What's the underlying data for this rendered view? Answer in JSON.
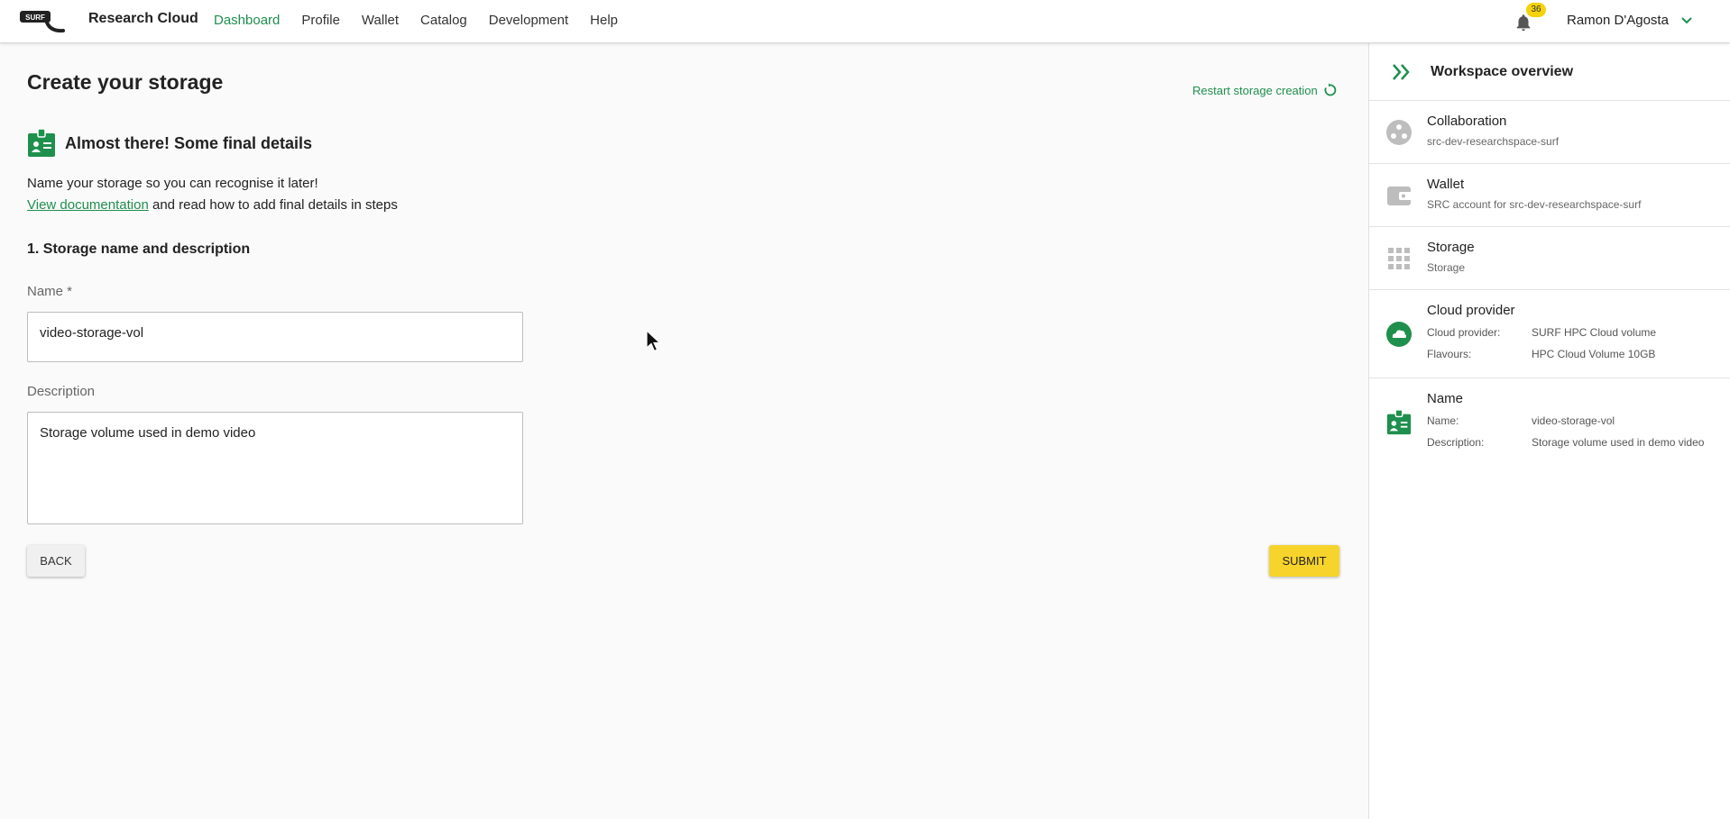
{
  "nav": {
    "brand": "Research Cloud",
    "logo_text": "SURF",
    "items": [
      "Dashboard",
      "Profile",
      "Wallet",
      "Catalog",
      "Development",
      "Help"
    ],
    "notifications": "36",
    "user": "Ramon D'Agosta"
  },
  "main": {
    "title": "Create your storage",
    "restart": "Restart storage creation",
    "step_title": "Almost there! Some final details",
    "intro_line1": "Name your storage so you can recognise it later!",
    "doc_link": "View documentation",
    "intro_line2": " and read how to add final details in steps",
    "section": "1. Storage name and description",
    "name_label": "Name *",
    "name_value": "video-storage-vol",
    "desc_label": "Description",
    "desc_value": "Storage volume used in demo video",
    "back": "BACK",
    "submit": "SUBMIT"
  },
  "panel": {
    "title": "Workspace overview",
    "collaboration": {
      "name": "Collaboration",
      "sub": "src-dev-researchspace-surf"
    },
    "wallet": {
      "name": "Wallet",
      "sub": "SRC account for src-dev-researchspace-surf"
    },
    "storage": {
      "name": "Storage",
      "sub": "Storage"
    },
    "cloud": {
      "name": "Cloud provider",
      "k1": "Cloud provider:",
      "v1": "SURF HPC Cloud volume",
      "k2": "Flavours:",
      "v2": "HPC Cloud Volume 10GB"
    },
    "named": {
      "name": "Name",
      "k1": "Name:",
      "v1": "video-storage-vol",
      "k2": "Description:",
      "v2": "Storage volume used in demo video"
    }
  },
  "colors": {
    "accent": "#1f8f4d",
    "submit": "#f7d42c",
    "badge": "#f5d20b"
  }
}
